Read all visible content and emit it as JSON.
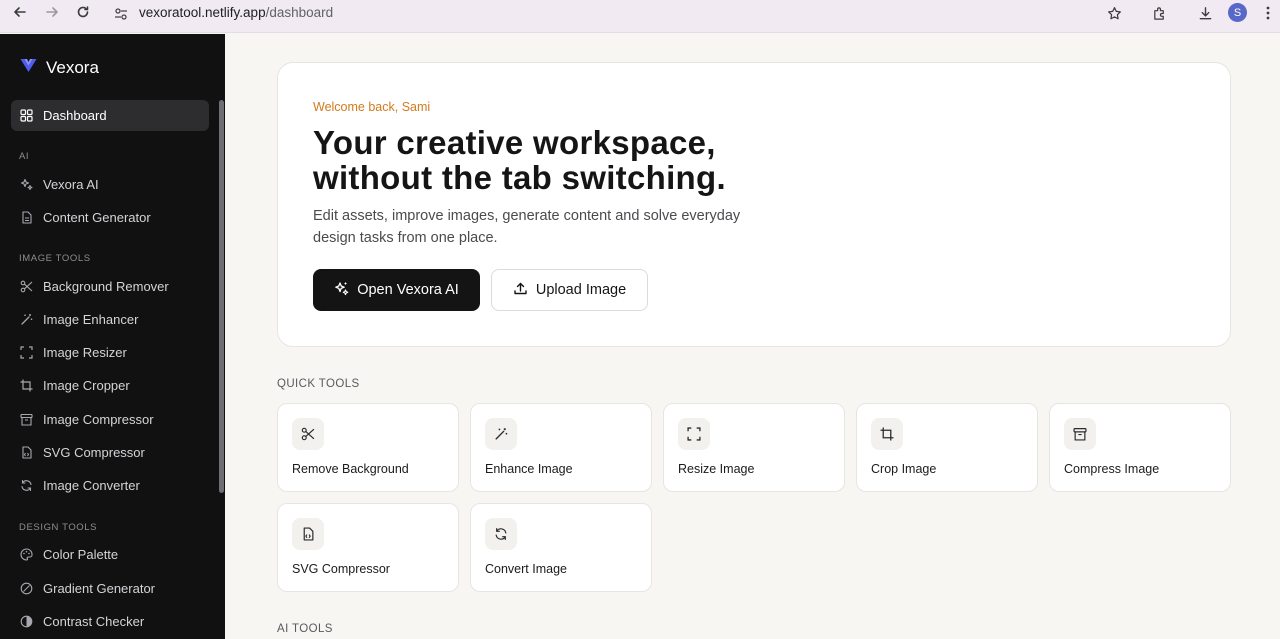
{
  "browser": {
    "url_host": "vexoratool.netlify.app",
    "url_path": "/dashboard",
    "profile_initial": "S"
  },
  "sidebar": {
    "brand": "Vexora",
    "dashboard": "Dashboard",
    "sections": {
      "ai": "AI",
      "image_tools": "IMAGE TOOLS",
      "design_tools": "DESIGN TOOLS"
    },
    "ai_items": [
      "Vexora AI",
      "Content Generator"
    ],
    "image_items": [
      "Background Remover",
      "Image Enhancer",
      "Image Resizer",
      "Image Cropper",
      "Image Compressor",
      "SVG Compressor",
      "Image Converter"
    ],
    "design_items": [
      "Color Palette",
      "Gradient Generator",
      "Contrast Checker"
    ]
  },
  "hero": {
    "welcome": "Welcome back, Sami",
    "title_line1": "Your creative workspace,",
    "title_line2": "without the tab switching.",
    "subtitle": "Edit assets, improve images, generate content and solve everyday design tasks from one place.",
    "primary_button": "Open Vexora AI",
    "secondary_button": "Upload Image"
  },
  "quick_tools": {
    "heading": "QUICK TOOLS",
    "items": [
      "Remove Background",
      "Enhance Image",
      "Resize Image",
      "Crop Image",
      "Compress Image",
      "SVG Compressor",
      "Convert Image"
    ]
  },
  "ai_tools": {
    "heading": "AI TOOLS"
  },
  "colors": {
    "accent_orange": "#d37a1c",
    "sidebar_bg": "#111112",
    "brand_blue": "#4f5cf0"
  }
}
